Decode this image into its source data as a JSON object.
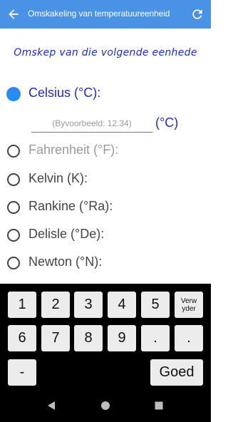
{
  "app_bar": {
    "title": "Omskakeling van temperatuureenheid",
    "back_icon": "arrow-left-icon",
    "refresh_icon": "refresh-icon",
    "color": "#4a92e6"
  },
  "subtitle": "Omskep van die volgende eenhede",
  "units": [
    {
      "label": "Celsius (°C):",
      "selected": true
    },
    {
      "label": "Fahrenheit (°F):",
      "selected": false
    },
    {
      "label": "Kelvin (K):",
      "selected": false
    },
    {
      "label": "Rankine (°Ra):",
      "selected": false
    },
    {
      "label": "Delisle (°De):",
      "selected": false
    },
    {
      "label": "Newton (°N):",
      "selected": false
    }
  ],
  "input": {
    "placeholder": "(Byvoorbeeld: 12.34)",
    "value": "",
    "unit": "(°C)"
  },
  "keyboard": {
    "row1": [
      "1",
      "2",
      "3",
      "4",
      "5"
    ],
    "delete_label": "Verwyder",
    "row2": [
      "6",
      "7",
      "8",
      "9",
      "."
    ],
    "minus": "-",
    "ok_label": "Goed"
  },
  "colors": {
    "accent_text": "#1e2bbd",
    "selected_radio": "#2a8cf0"
  },
  "nav_icons": [
    "back-triangle-icon",
    "home-circle-icon",
    "recents-square-icon"
  ]
}
